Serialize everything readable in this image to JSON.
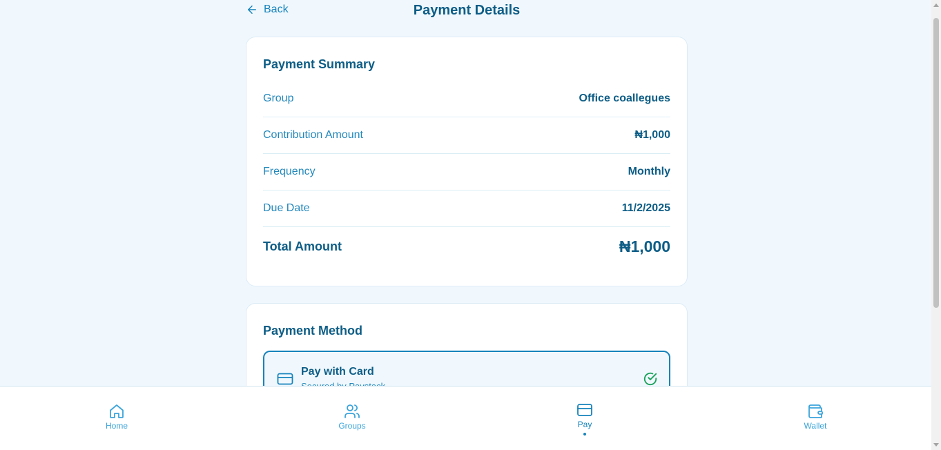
{
  "header": {
    "back_label": "Back",
    "title": "Payment Details"
  },
  "summary": {
    "title": "Payment Summary",
    "rows": [
      {
        "label": "Group",
        "value": "Office coallegues"
      },
      {
        "label": "Contribution Amount",
        "value": "₦1,000"
      },
      {
        "label": "Frequency",
        "value": "Monthly"
      },
      {
        "label": "Due Date",
        "value": "11/2/2025"
      }
    ],
    "total_label": "Total Amount",
    "total_value": "₦1,000"
  },
  "payment_method": {
    "title": "Payment Method",
    "option_title": "Pay with Card",
    "option_subtitle": "Secured by Paystack",
    "selected": true
  },
  "nav": {
    "items": [
      {
        "label": "Home",
        "icon": "home-icon"
      },
      {
        "label": "Groups",
        "icon": "users-icon"
      },
      {
        "label": "Pay",
        "icon": "credit-card-icon",
        "active": true
      },
      {
        "label": "Wallet",
        "icon": "wallet-icon"
      }
    ]
  },
  "colors": {
    "accent": "#1683bb",
    "text_dark": "#0d5d86",
    "background": "#f0f8fe",
    "success": "#18a15a"
  }
}
